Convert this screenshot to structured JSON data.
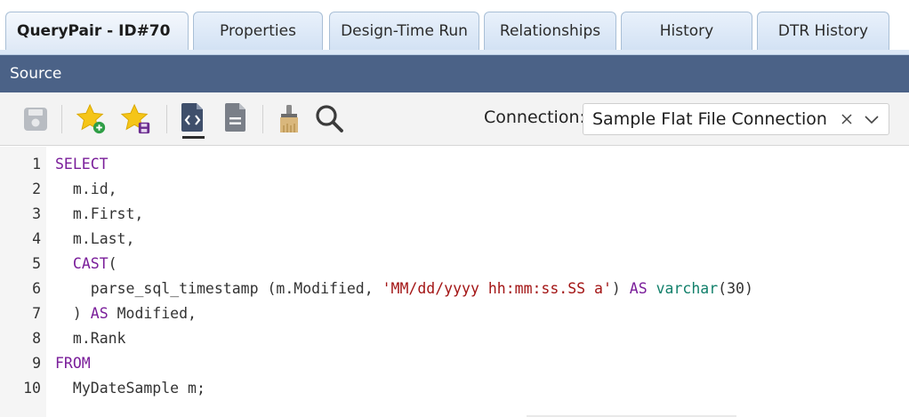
{
  "tabs": [
    {
      "label": "QueryPair - ID#70",
      "active": true
    },
    {
      "label": "Properties",
      "active": false
    },
    {
      "label": "Design-Time Run",
      "active": false
    },
    {
      "label": "Relationships",
      "active": false
    },
    {
      "label": "History",
      "active": false
    },
    {
      "label": "DTR History",
      "active": false
    }
  ],
  "section": {
    "title": "Source"
  },
  "toolbar": {
    "buttons": [
      {
        "icon": "save-icon"
      },
      {
        "icon": "add-favorite-icon"
      },
      {
        "icon": "save-favorite-icon"
      },
      {
        "icon": "code-view-icon",
        "active": true
      },
      {
        "icon": "document-view-icon"
      },
      {
        "icon": "format-brush-icon"
      },
      {
        "icon": "search-icon"
      }
    ]
  },
  "connection": {
    "label": "Connection:",
    "value": "Sample Flat File Connection"
  },
  "editor": {
    "lines": [
      {
        "num": "1",
        "indent": "",
        "tokens": [
          {
            "t": "SELECT",
            "c": "kw"
          }
        ]
      },
      {
        "num": "2",
        "indent": "  ",
        "tokens": [
          {
            "t": "m.id,",
            "c": ""
          }
        ]
      },
      {
        "num": "3",
        "indent": "  ",
        "tokens": [
          {
            "t": "m.First,",
            "c": ""
          }
        ]
      },
      {
        "num": "4",
        "indent": "  ",
        "tokens": [
          {
            "t": "m.Last,",
            "c": ""
          }
        ]
      },
      {
        "num": "5",
        "indent": "  ",
        "tokens": [
          {
            "t": "CAST",
            "c": "kw"
          },
          {
            "t": "(",
            "c": ""
          }
        ]
      },
      {
        "num": "6",
        "indent": "    ",
        "tokens": [
          {
            "t": "parse_sql_timestamp (m.Modified, ",
            "c": ""
          },
          {
            "t": "'MM/dd/yyyy hh:mm:ss.SS a'",
            "c": "str"
          },
          {
            "t": ") ",
            "c": ""
          },
          {
            "t": "AS",
            "c": "kw"
          },
          {
            "t": " ",
            "c": ""
          },
          {
            "t": "varchar",
            "c": "typ"
          },
          {
            "t": "(30)",
            "c": ""
          }
        ]
      },
      {
        "num": "7",
        "indent": "  ",
        "tokens": [
          {
            "t": ") ",
            "c": ""
          },
          {
            "t": "AS",
            "c": "kw"
          },
          {
            "t": " Modified,",
            "c": ""
          }
        ]
      },
      {
        "num": "8",
        "indent": "  ",
        "tokens": [
          {
            "t": "m.Rank",
            "c": ""
          }
        ]
      },
      {
        "num": "9",
        "indent": "",
        "tokens": [
          {
            "t": "FROM",
            "c": "kw"
          }
        ]
      },
      {
        "num": "10",
        "indent": "  ",
        "tokens": [
          {
            "t": "MyDateSample m;",
            "c": ""
          }
        ]
      }
    ]
  },
  "colors": {
    "header": "#4b6287",
    "keyword": "#7a1e9a",
    "string": "#a31515",
    "type": "#12806b",
    "star": "#f5c518"
  }
}
